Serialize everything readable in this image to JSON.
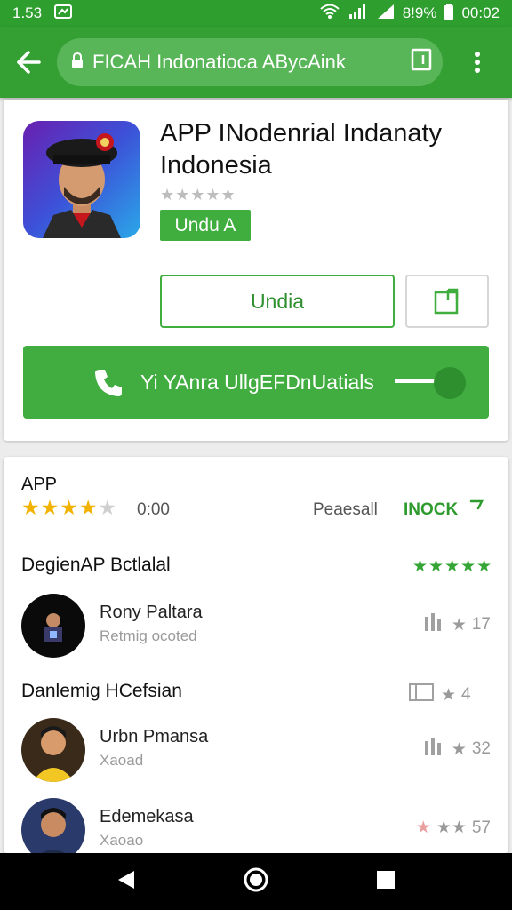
{
  "status": {
    "left_text": "1.53",
    "battery": "8!9%",
    "time": "00:02"
  },
  "toolbar": {
    "url": "FICAH Indonatioca ABycAink"
  },
  "app": {
    "title": "APP INodenrial Indanaty Indonesia",
    "tag_label": "Undu A",
    "install_label": "Undia",
    "call_label": "Yi YAnra UllgEFDnUatials"
  },
  "ratings": {
    "section_title": "APP",
    "stars_filled": 4,
    "stars_total": 5,
    "value": "0:00",
    "preinstall": "Peaesall",
    "action": "INOCK"
  },
  "group1": {
    "title": "DegienAP Bctlalal",
    "stars": "★★★★★"
  },
  "group2": {
    "title": "Danlemig HCefsian",
    "count": "4"
  },
  "rows": [
    {
      "name": "Rony Paltara",
      "sub": "Retmig ocoted",
      "count": "17"
    },
    {
      "name": "Urbn Pmansa",
      "sub": "Xaoad",
      "count": "32"
    },
    {
      "name": "Edemekasa",
      "sub": "Xaoao",
      "count": "57"
    }
  ],
  "colors": {
    "brand_green": "#34a034",
    "accent_green": "#41ad41",
    "star_gold": "#f2b200"
  }
}
